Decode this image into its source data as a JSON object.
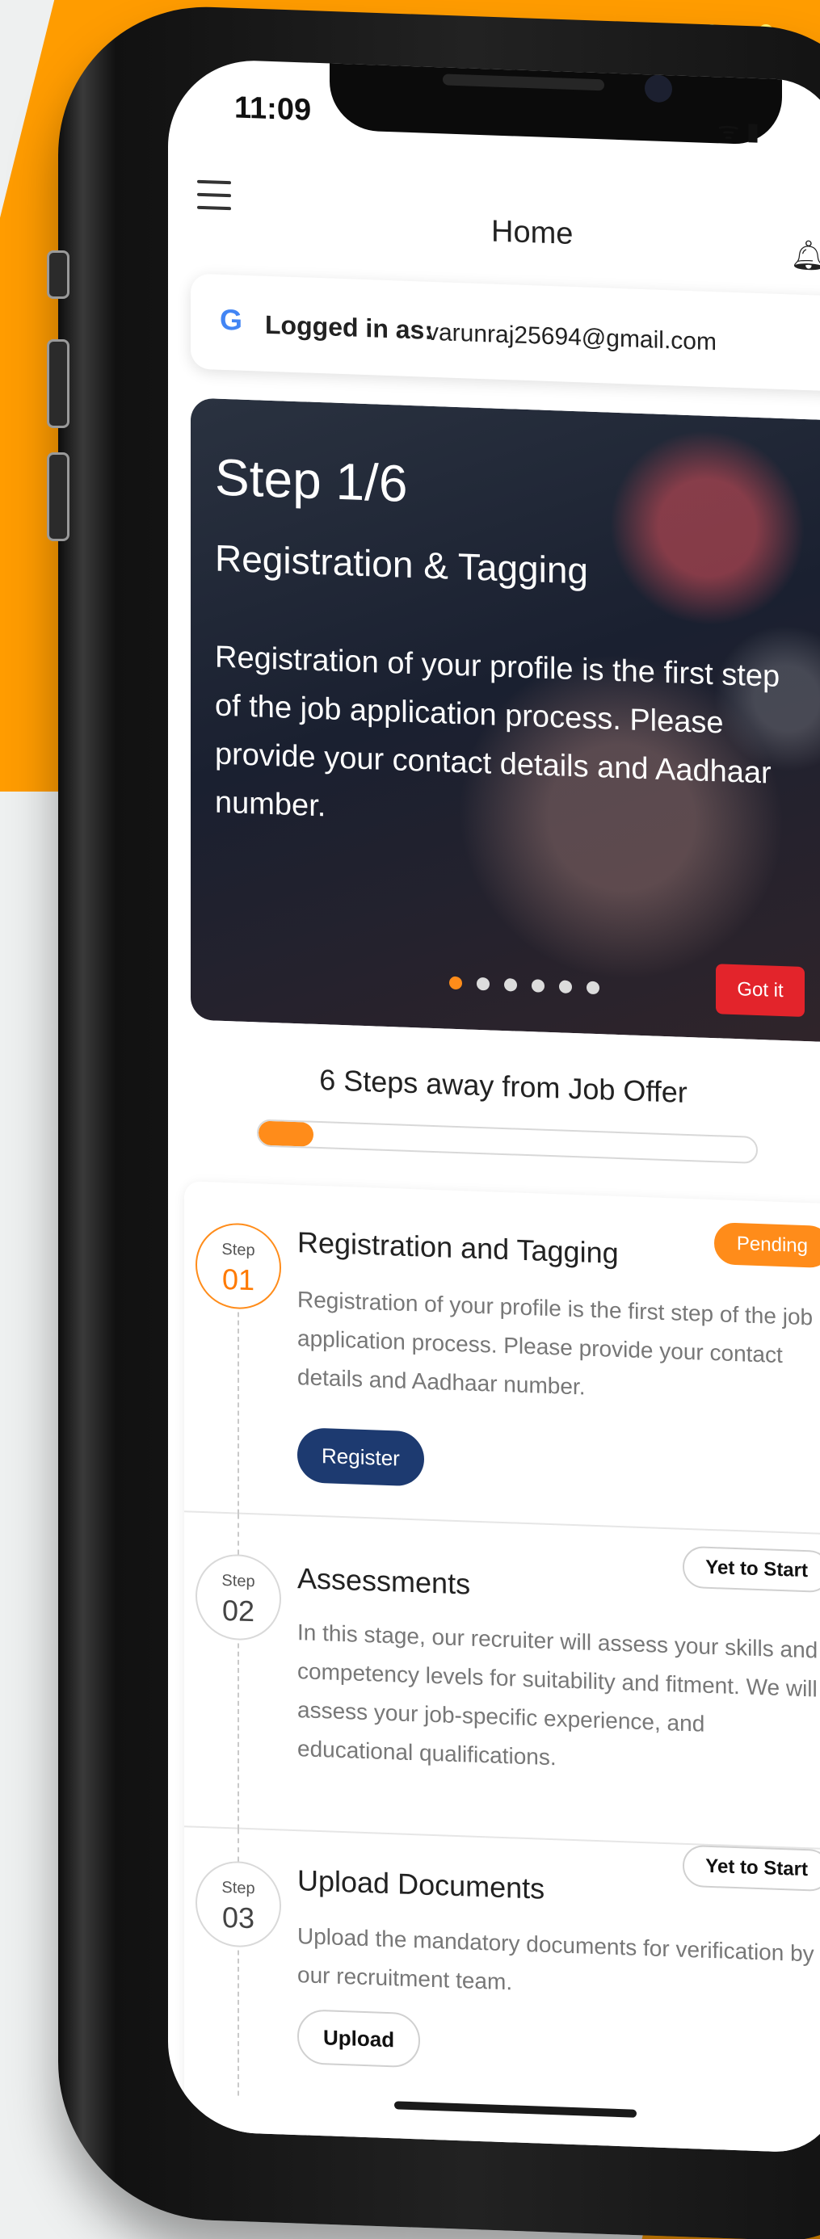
{
  "status_bar": {
    "time": "11:09",
    "icons": "ᯤ ▮"
  },
  "header": {
    "title": "Home"
  },
  "login": {
    "label": "Logged in as:",
    "email": "varunraj25694@gmail.com"
  },
  "hero": {
    "step": "Step 1/6",
    "title": "Registration & Tagging",
    "description": "Registration of your profile is the first step of the job application process. Please provide your contact details and Aadhaar number.",
    "button": "Got it",
    "dots_total": 6,
    "dots_active": 1
  },
  "progress": {
    "label": "6 Steps away from Job Offer",
    "value": 0.11
  },
  "steps": [
    {
      "step_label": "Step",
      "number": "01",
      "title": "Registration and Tagging",
      "status": "Pending",
      "description": "Registration of your profile is the first step of the job application process. Please provide your contact details and Aadhaar number.",
      "action": "Register"
    },
    {
      "step_label": "Step",
      "number": "02",
      "title": "Assessments",
      "status": "Yet to Start",
      "description": "In this stage, our recruiter will assess your skills and competency levels for suitability and fitment. We will assess your job-specific experience, and educational qualifications."
    },
    {
      "step_label": "Step",
      "number": "03",
      "title": "Upload Documents",
      "status": "Yet to Start",
      "description": "Upload the mandatory documents for verification by our recruitment team.",
      "action": "Upload"
    }
  ],
  "colors": {
    "accent": "#ff8c1a",
    "primary_button": "#1d3a70",
    "gotit": "#e3242b",
    "background_orange": "#ff9c00"
  }
}
